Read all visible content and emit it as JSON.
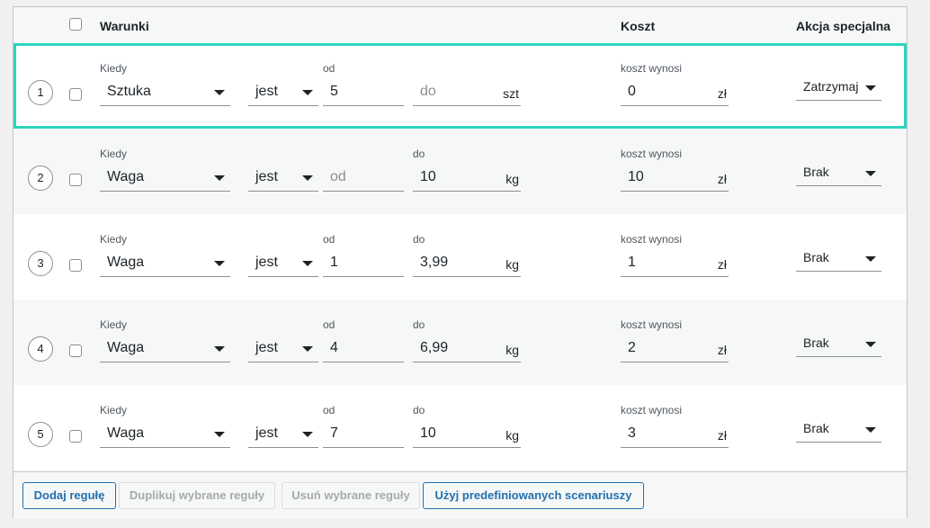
{
  "header": {
    "conditions": "Warunki",
    "cost": "Koszt",
    "action": "Akcja specjalna"
  },
  "rows": [
    {
      "number": "1",
      "when_label": "Kiedy",
      "condition": "Sztuka",
      "operator": "jest",
      "from_label": "od",
      "from_value": "5",
      "from_placeholder": "",
      "to_label": "",
      "to_value": "",
      "to_placeholder": "do",
      "unit": "szt",
      "cost_label": "koszt wynosi",
      "cost_value": "0",
      "currency": "zł",
      "action": "Zatrzymaj"
    },
    {
      "number": "2",
      "when_label": "Kiedy",
      "condition": "Waga",
      "operator": "jest",
      "from_label": "",
      "from_value": "",
      "from_placeholder": "od",
      "to_label": "do",
      "to_value": "10",
      "to_placeholder": "",
      "unit": "kg",
      "cost_label": "koszt wynosi",
      "cost_value": "10",
      "currency": "zł",
      "action": "Brak"
    },
    {
      "number": "3",
      "when_label": "Kiedy",
      "condition": "Waga",
      "operator": "jest",
      "from_label": "od",
      "from_value": "1",
      "from_placeholder": "",
      "to_label": "do",
      "to_value": "3,99",
      "to_placeholder": "",
      "unit": "kg",
      "cost_label": "koszt wynosi",
      "cost_value": "1",
      "currency": "zł",
      "action": "Brak"
    },
    {
      "number": "4",
      "when_label": "Kiedy",
      "condition": "Waga",
      "operator": "jest",
      "from_label": "od",
      "from_value": "4",
      "from_placeholder": "",
      "to_label": "do",
      "to_value": "6,99",
      "to_placeholder": "",
      "unit": "kg",
      "cost_label": "koszt wynosi",
      "cost_value": "2",
      "currency": "zł",
      "action": "Brak"
    },
    {
      "number": "5",
      "when_label": "Kiedy",
      "condition": "Waga",
      "operator": "jest",
      "from_label": "od",
      "from_value": "7",
      "from_placeholder": "",
      "to_label": "do",
      "to_value": "10",
      "to_placeholder": "",
      "unit": "kg",
      "cost_label": "koszt wynosi",
      "cost_value": "3",
      "currency": "zł",
      "action": "Brak"
    }
  ],
  "footer": {
    "add": "Dodaj regułę",
    "duplicate": "Duplikuj wybrane reguły",
    "remove": "Usuń wybrane reguły",
    "predefined": "Użyj predefiniowanych scenariuszy"
  },
  "colors": {
    "highlight_border": "#2bd5be",
    "primary": "#2271b1"
  }
}
